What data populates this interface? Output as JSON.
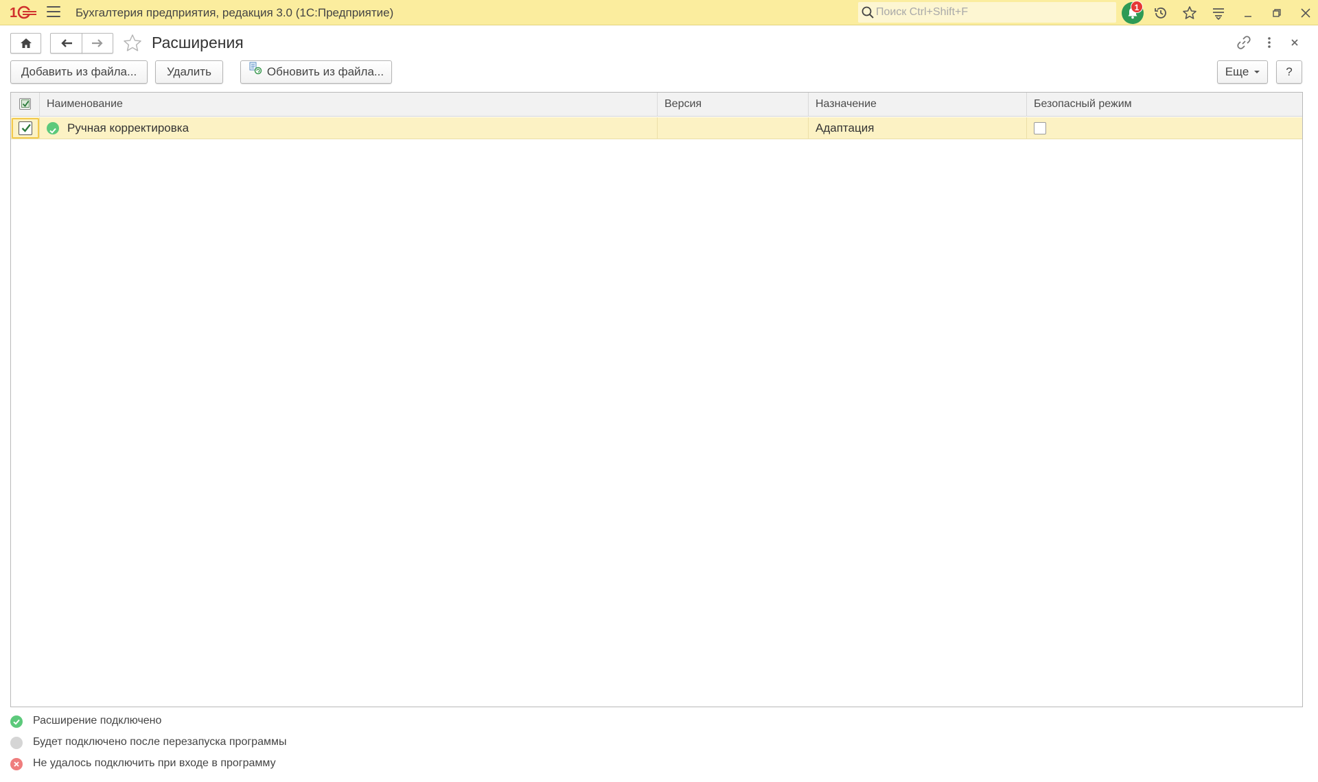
{
  "window": {
    "app_title": "Бухгалтерия предприятия, редакция 3.0  (1С:Предприятие)",
    "logo_text": "1С",
    "search_placeholder": "Поиск Ctrl+Shift+F",
    "notifications_count": "1"
  },
  "form": {
    "title": "Расширения",
    "toolbar": {
      "add_from_file": "Добавить из файла...",
      "delete": "Удалить",
      "update_from_file": "Обновить из файла...",
      "more": "Еще",
      "help": "?"
    }
  },
  "table": {
    "columns": [
      "Наименование",
      "Версия",
      "Назначение",
      "Безопасный режим"
    ],
    "rows": [
      {
        "active": true,
        "status": "connected",
        "name": "Ручная корректировка",
        "version": "",
        "purpose": "Адаптация",
        "safe_mode": false
      }
    ]
  },
  "legend": [
    {
      "status": "connected",
      "text": "Расширение подключено"
    },
    {
      "status": "pending",
      "text": "Будет подключено после перезапуска программы"
    },
    {
      "status": "failed",
      "text": "Не удалось подключить при входе в программу"
    }
  ],
  "colors": {
    "titlebar_bg": "#fbed9e",
    "selected_row_bg": "#fcf2c4",
    "status_connected": "#5cc97b",
    "status_pending": "#d5d5d5",
    "status_failed": "#ef7d7d",
    "brand_red": "#d0312d"
  }
}
